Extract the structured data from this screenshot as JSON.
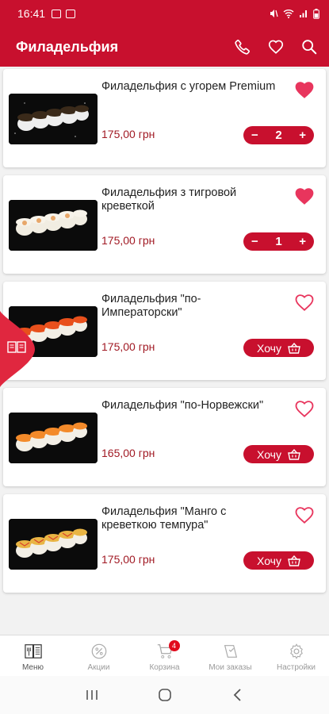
{
  "status_bar": {
    "time": "16:41"
  },
  "header": {
    "title": "Филадельфия"
  },
  "products": [
    {
      "name": "Филадельфия с угорем Premium",
      "price": "175,00 грн",
      "favorite": true,
      "in_cart": true,
      "quantity": "2"
    },
    {
      "name": "Филадельфия з тигровой креветкой",
      "price": "175,00 грн",
      "favorite": true,
      "in_cart": true,
      "quantity": "1"
    },
    {
      "name": "Филадельфия \"по-Императорски\"",
      "price": "175,00 грн",
      "favorite": false,
      "in_cart": false,
      "button_label": "Хочу"
    },
    {
      "name": "Филадельфия \"по-Норвежски\"",
      "price": "165,00 грн",
      "favorite": false,
      "in_cart": false,
      "button_label": "Хочу"
    },
    {
      "name": "Филадельфия \"Манго с креветкою темпура\"",
      "price": "175,00 грн",
      "favorite": false,
      "in_cart": false,
      "button_label": "Хочу"
    }
  ],
  "stepper": {
    "minus": "−",
    "plus": "+"
  },
  "bottom_nav": {
    "items": [
      {
        "label": "Меню",
        "icon": "menu-book-icon",
        "active": true
      },
      {
        "label": "Акции",
        "icon": "percent-icon",
        "active": false
      },
      {
        "label": "Корзина",
        "icon": "cart-icon",
        "active": false,
        "badge": "4"
      },
      {
        "label": "Мои заказы",
        "icon": "orders-icon",
        "active": false
      },
      {
        "label": "Настройки",
        "icon": "gear-icon",
        "active": false
      }
    ]
  },
  "colors": {
    "primary": "#c8102e",
    "price": "#a11a24",
    "heart": "#e8355d"
  }
}
